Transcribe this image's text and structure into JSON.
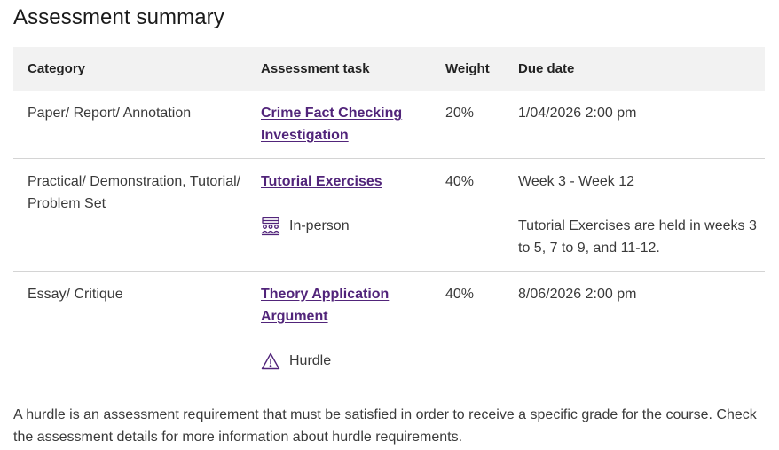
{
  "heading": "Assessment summary",
  "table": {
    "headers": [
      "Category",
      "Assessment task",
      "Weight",
      "Due date"
    ],
    "rows": [
      {
        "category": "Paper/ Report/ Annotation",
        "task": "Crime Fact Checking Investigation",
        "weight": "20%",
        "due": "1/04/2026 2:00 pm"
      },
      {
        "category": "Practical/ Demonstration, Tutorial/ Problem Set",
        "task": "Tutorial Exercises",
        "mode_icon": "in-person-icon",
        "mode_label": "In-person",
        "weight": "40%",
        "due": "Week 3 - Week 12",
        "due_note": "Tutorial Exercises are held in weeks 3 to 5, 7 to 9, and 11-12."
      },
      {
        "category": "Essay/ Critique",
        "task": "Theory Application Argument",
        "mode_icon": "warning-icon",
        "mode_label": "Hurdle",
        "weight": "40%",
        "due": "8/06/2026 2:00 pm"
      }
    ]
  },
  "footnote": "A hurdle is an assessment requirement that must be satisfied in order to receive a specific grade for the course. Check the assessment details for more information about hurdle requirements.",
  "colors": {
    "link": "#51247a",
    "header_bg": "#f2f2f2",
    "divider": "#d4d4d4",
    "text": "#3a3a3a"
  }
}
